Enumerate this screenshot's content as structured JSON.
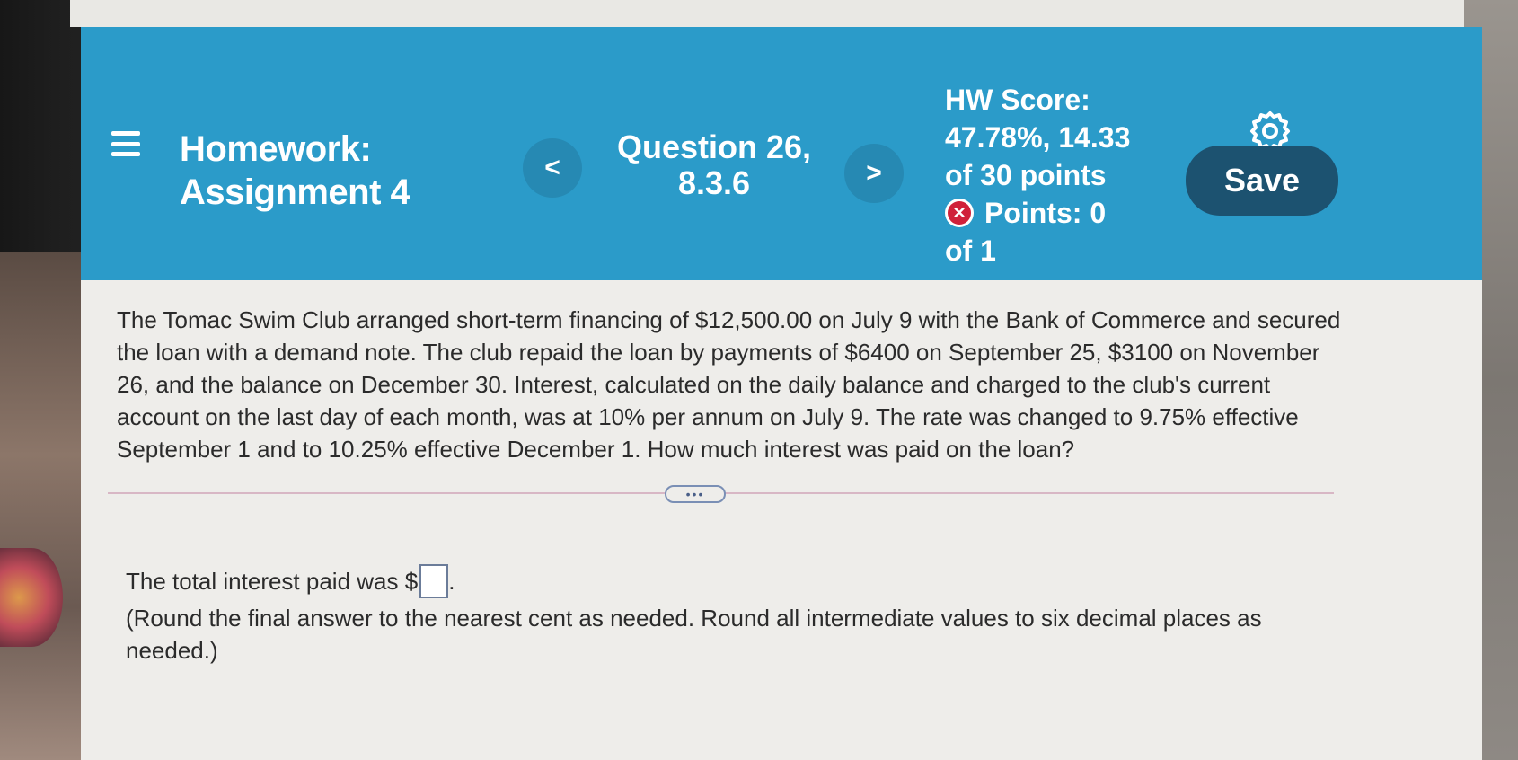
{
  "header": {
    "assignment_title": "Homework:",
    "assignment_name": "Assignment 4",
    "question_label": "Question 26,",
    "question_number": "8.3.6",
    "prev_symbol": "<",
    "next_symbol": ">",
    "hw_score_label": "HW Score:",
    "hw_score_value": "47.78%, 14.33",
    "hw_score_total": "of 30 points",
    "points_label": "Points: 0",
    "points_total": "of 1",
    "save_label": "Save",
    "colors": {
      "header_bg": "#2b9bc9",
      "save_bg": "#1c5270",
      "incorrect_icon": "#d0213a"
    },
    "icons": [
      "menu-icon",
      "chevron-left-icon",
      "chevron-right-icon",
      "incorrect-x-icon",
      "gear-icon"
    ]
  },
  "question": {
    "text": "The Tomac Swim Club arranged short-term financing of $12,500.00 on July 9 with the Bank of Commerce and secured the loan with a demand note. The club repaid the loan by payments of $6400 on September 25, $3100 on November 26, and the balance on December 30. Interest, calculated on the daily balance and charged to the club's current account on the last day of each month, was at 10% per annum on July 9. The rate was changed to 9.75% effective September 1 and to 10.25% effective December 1. How much interest was paid on the loan?"
  },
  "expand_label": "•••",
  "answer": {
    "prefix": "The total interest paid was $",
    "value": "",
    "suffix": ".",
    "note": "(Round the final answer to the nearest cent as needed. Round all intermediate values to six decimal places as needed.)"
  }
}
